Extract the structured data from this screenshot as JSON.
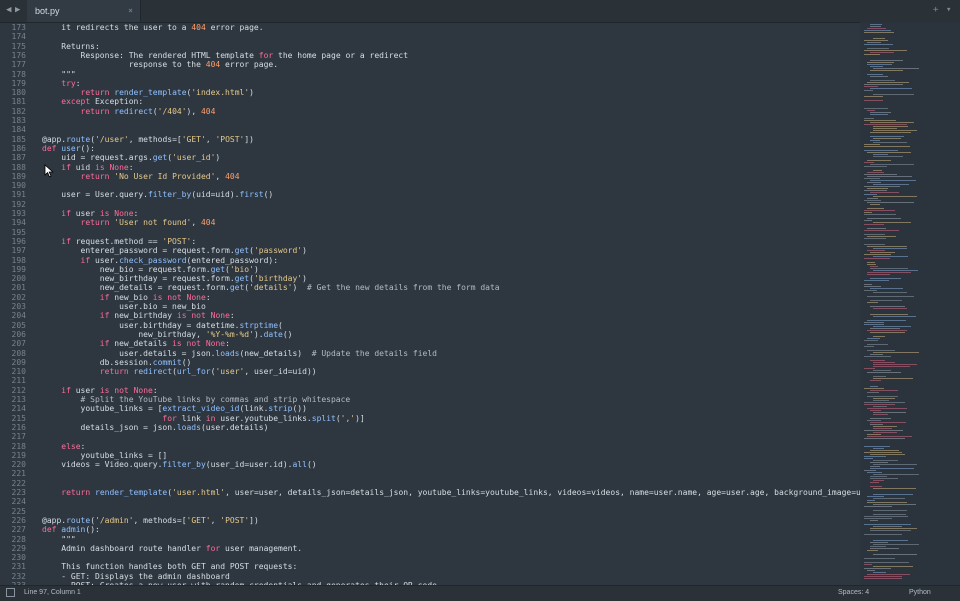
{
  "tabs": [
    {
      "label": "bot.py",
      "close": "×"
    }
  ],
  "toolbar": {
    "back": "◀",
    "forward": "▶",
    "add": "+",
    "menu": "▾"
  },
  "status": {
    "position": "Line 97, Column 1",
    "spaces": "Spaces: 4",
    "syntax": "Python"
  },
  "code": {
    "lines": [
      {
        "n": "173",
        "t": "    it redirects the user to a 404 error page."
      },
      {
        "n": "174",
        "t": ""
      },
      {
        "n": "175",
        "t": "    Returns:"
      },
      {
        "n": "176",
        "t": "        Response: The rendered HTML template for the home page or a redirect"
      },
      {
        "n": "177",
        "t": "                  response to the 404 error page."
      },
      {
        "n": "178",
        "t": "    \"\"\""
      },
      {
        "n": "179",
        "t": "    try:"
      },
      {
        "n": "180",
        "t": "        return render_template('index.html')"
      },
      {
        "n": "181",
        "t": "    except Exception:"
      },
      {
        "n": "182",
        "t": "        return redirect('/404'), 404"
      },
      {
        "n": "183",
        "t": ""
      },
      {
        "n": "184",
        "t": ""
      },
      {
        "n": "185",
        "t": "@app.route('/user', methods=['GET', 'POST'])"
      },
      {
        "n": "186",
        "t": "def user():"
      },
      {
        "n": "187",
        "t": "    uid = request.args.get('user_id')"
      },
      {
        "n": "188",
        "t": "    if uid is None:"
      },
      {
        "n": "189",
        "t": "        return 'No User Id Provided', 404"
      },
      {
        "n": "190",
        "t": ""
      },
      {
        "n": "191",
        "t": "    user = User.query.filter_by(uid=uid).first()"
      },
      {
        "n": "192",
        "t": ""
      },
      {
        "n": "193",
        "t": "    if user is None:"
      },
      {
        "n": "194",
        "t": "        return 'User not found', 404"
      },
      {
        "n": "195",
        "t": ""
      },
      {
        "n": "196",
        "t": "    if request.method == 'POST':"
      },
      {
        "n": "197",
        "t": "        entered_password = request.form.get('password')"
      },
      {
        "n": "198",
        "t": "        if user.check_password(entered_password):"
      },
      {
        "n": "199",
        "t": "            new_bio = request.form.get('bio')"
      },
      {
        "n": "200",
        "t": "            new_birthday = request.form.get('birthday')"
      },
      {
        "n": "201",
        "t": "            new_details = request.form.get('details')  # Get the new details from the form data"
      },
      {
        "n": "202",
        "t": "            if new_bio is not None:"
      },
      {
        "n": "203",
        "t": "                user.bio = new_bio"
      },
      {
        "n": "204",
        "t": "            if new_birthday is not None:"
      },
      {
        "n": "205",
        "t": "                user.birthday = datetime.strptime("
      },
      {
        "n": "206",
        "t": "                    new_birthday, '%Y-%m-%d').date()"
      },
      {
        "n": "207",
        "t": "            if new_details is not None:"
      },
      {
        "n": "208",
        "t": "                user.details = json.loads(new_details)  # Update the details field"
      },
      {
        "n": "209",
        "t": "            db.session.commit()"
      },
      {
        "n": "210",
        "t": "            return redirect(url_for('user', user_id=uid))"
      },
      {
        "n": "211",
        "t": ""
      },
      {
        "n": "212",
        "t": "    if user is not None:"
      },
      {
        "n": "213",
        "t": "        # Split the YouTube links by commas and strip whitespace"
      },
      {
        "n": "214",
        "t": "        youtube_links = [extract_video_id(link.strip())"
      },
      {
        "n": "215",
        "t": "                         for link in user.youtube_links.split(',')]"
      },
      {
        "n": "216",
        "t": "        details_json = json.loads(user.details)"
      },
      {
        "n": "217",
        "t": ""
      },
      {
        "n": "218",
        "t": "    else:"
      },
      {
        "n": "219",
        "t": "        youtube_links = []"
      },
      {
        "n": "220",
        "t": "    videos = Video.query.filter_by(user_id=user.id).all()"
      },
      {
        "n": "221",
        "t": ""
      },
      {
        "n": "222",
        "t": ""
      },
      {
        "n": "223",
        "t": "    return render_template('user.html', user=user, details_json=details_json, youtube_links=youtube_links, videos=videos, name=user.name, age=user.age, background_image=user.b"
      },
      {
        "n": "224",
        "t": ""
      },
      {
        "n": "225",
        "t": ""
      },
      {
        "n": "226",
        "t": "@app.route('/admin', methods=['GET', 'POST'])"
      },
      {
        "n": "227",
        "t": "def admin():"
      },
      {
        "n": "228",
        "t": "    \"\"\""
      },
      {
        "n": "229",
        "t": "    Admin dashboard route handler for user management."
      },
      {
        "n": "230",
        "t": ""
      },
      {
        "n": "231",
        "t": "    This function handles both GET and POST requests:"
      },
      {
        "n": "232",
        "t": "    - GET: Displays the admin dashboard"
      },
      {
        "n": "233",
        "t": "    - POST: Creates a new user with random credentials and generates their QR code"
      }
    ]
  },
  "colors": {
    "background": "#2e3740",
    "keyword": "#ff6b9a",
    "string": "#e6c98a",
    "function": "#8fc0ff",
    "number": "#ff9f6b",
    "text": "#d7dde3"
  }
}
